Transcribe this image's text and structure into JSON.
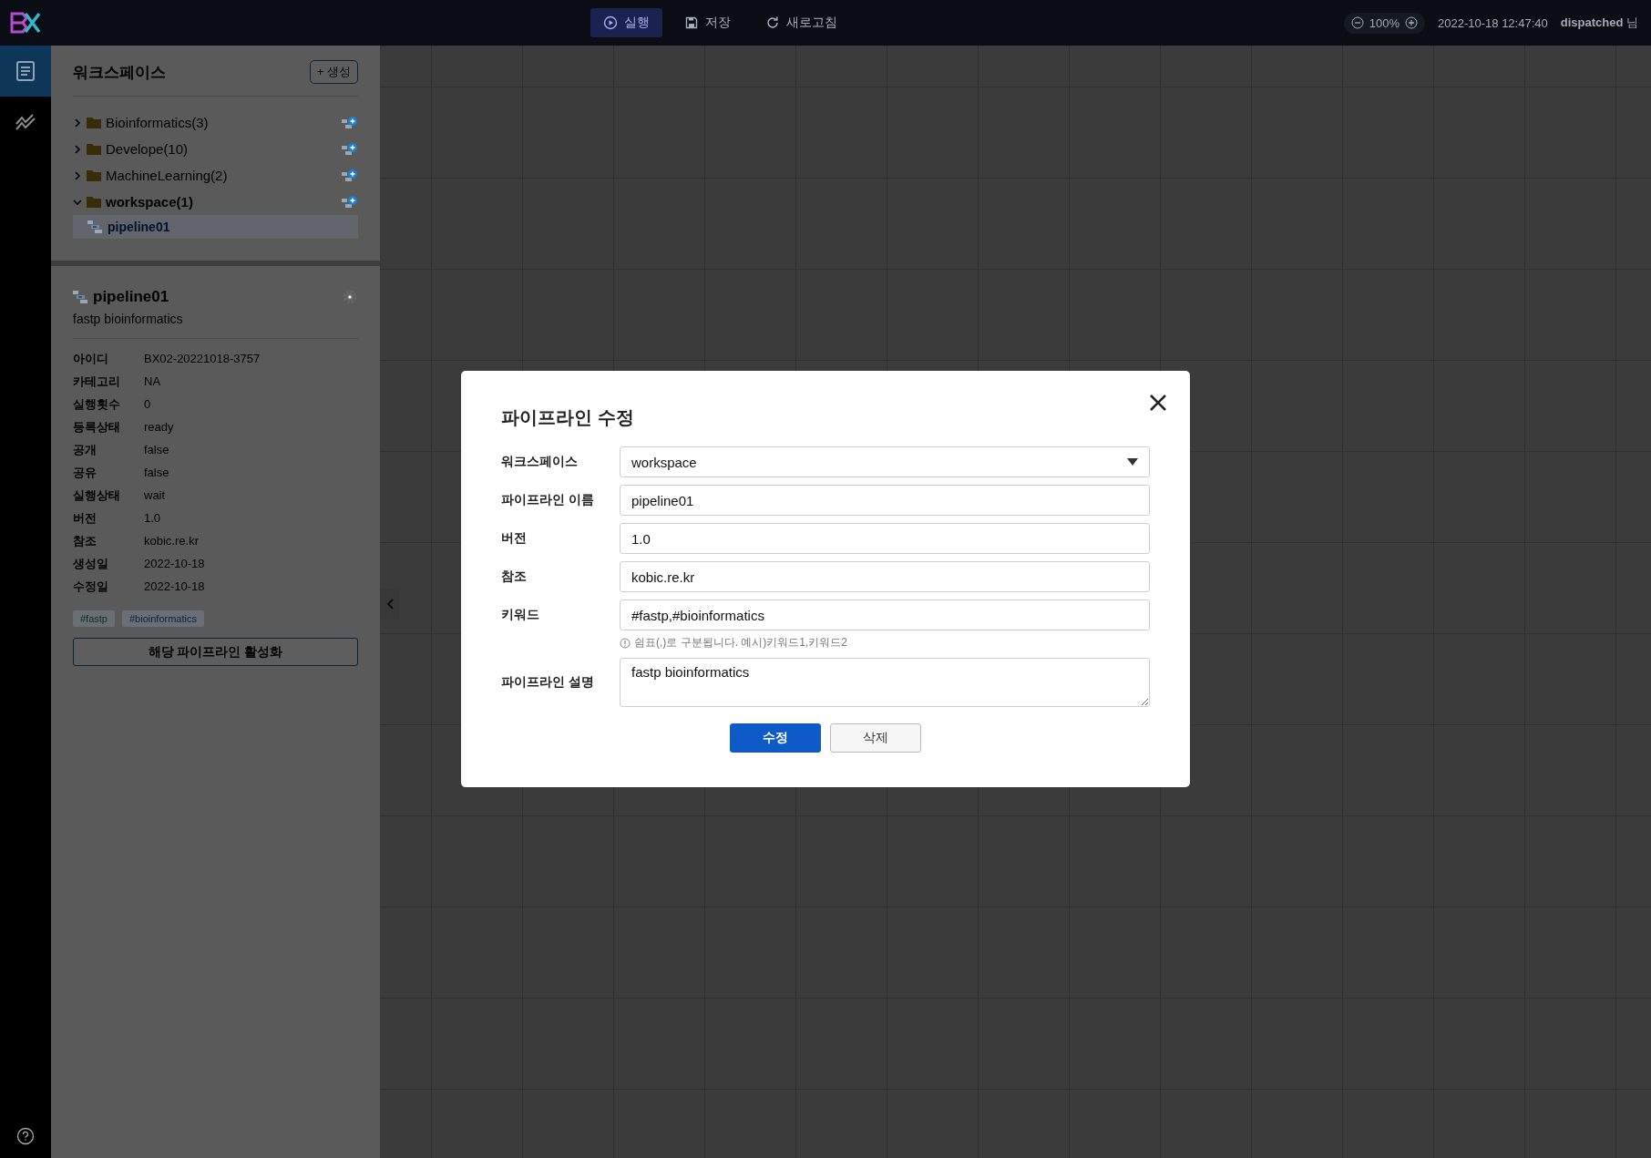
{
  "top_bar": {
    "toolbar": [
      {
        "kind": "run",
        "label": "실행",
        "selected": true
      },
      {
        "kind": "save",
        "label": "저장",
        "selected": false
      },
      {
        "kind": "refresh",
        "label": "새로고침",
        "selected": false
      }
    ],
    "zoom": "100%",
    "timestamp": "2022-10-18 12:47:40",
    "user": "dispatched",
    "user_suffix": "님"
  },
  "rail": [
    {
      "kind": "document",
      "selected": true
    },
    {
      "kind": "chart",
      "selected": false
    }
  ],
  "sidebar": {
    "title": "워크스페이스",
    "create_button": "+ 생성",
    "tree": [
      {
        "label": "Bioinformatics(3)",
        "expanded": false
      },
      {
        "label": "Develope(10)",
        "expanded": false
      },
      {
        "label": "MachineLearning(2)",
        "expanded": false
      },
      {
        "label": "workspace(1)",
        "expanded": true,
        "children": [
          {
            "label": "pipeline01",
            "selected": true
          }
        ]
      }
    ]
  },
  "details": {
    "name": "pipeline01",
    "description": "fastp bioinformatics",
    "fields": [
      {
        "label": "아이디",
        "value": "BX02-20221018-3757"
      },
      {
        "label": "카테고리",
        "value": "NA"
      },
      {
        "label": "실행횟수",
        "value": "0"
      },
      {
        "label": "등록상태",
        "value": "ready"
      },
      {
        "label": "공개",
        "value": "false"
      },
      {
        "label": "공유",
        "value": "false"
      },
      {
        "label": "실행상태",
        "value": "wait"
      },
      {
        "label": "버전",
        "value": "1.0"
      },
      {
        "label": "참조",
        "value": "kobic.re.kr"
      },
      {
        "label": "생성일",
        "value": "2022-10-18"
      },
      {
        "label": "수정일",
        "value": "2022-10-18"
      }
    ],
    "tags": [
      {
        "label": "#fastp",
        "color": "#06301c"
      },
      {
        "label": "#bioinformatics",
        "color": "#0a1f44"
      }
    ],
    "activate_button": "해당 파이프라인 활성화"
  },
  "modal": {
    "title": "파이프라인 수정",
    "fields": [
      {
        "kind": "select",
        "label": "워크스페이스",
        "value": "workspace"
      },
      {
        "kind": "text",
        "label": "파이프라인 이름",
        "value": "pipeline01"
      },
      {
        "kind": "text",
        "label": "버전",
        "value": "1.0"
      },
      {
        "kind": "text",
        "label": "참조",
        "value": "kobic.re.kr"
      },
      {
        "kind": "text",
        "label": "키워드",
        "value": "#fastp,#bioinformatics",
        "hint": "쉼표(,)로 구분됩니다. 예시)키워드1,키워드2"
      },
      {
        "kind": "textarea",
        "label": "파이프라인 설명",
        "value": "fastp bioinformatics"
      }
    ],
    "buttons": [
      {
        "kind": "primary",
        "label": "수정"
      },
      {
        "kind": "secondary",
        "label": "삭제"
      }
    ]
  }
}
